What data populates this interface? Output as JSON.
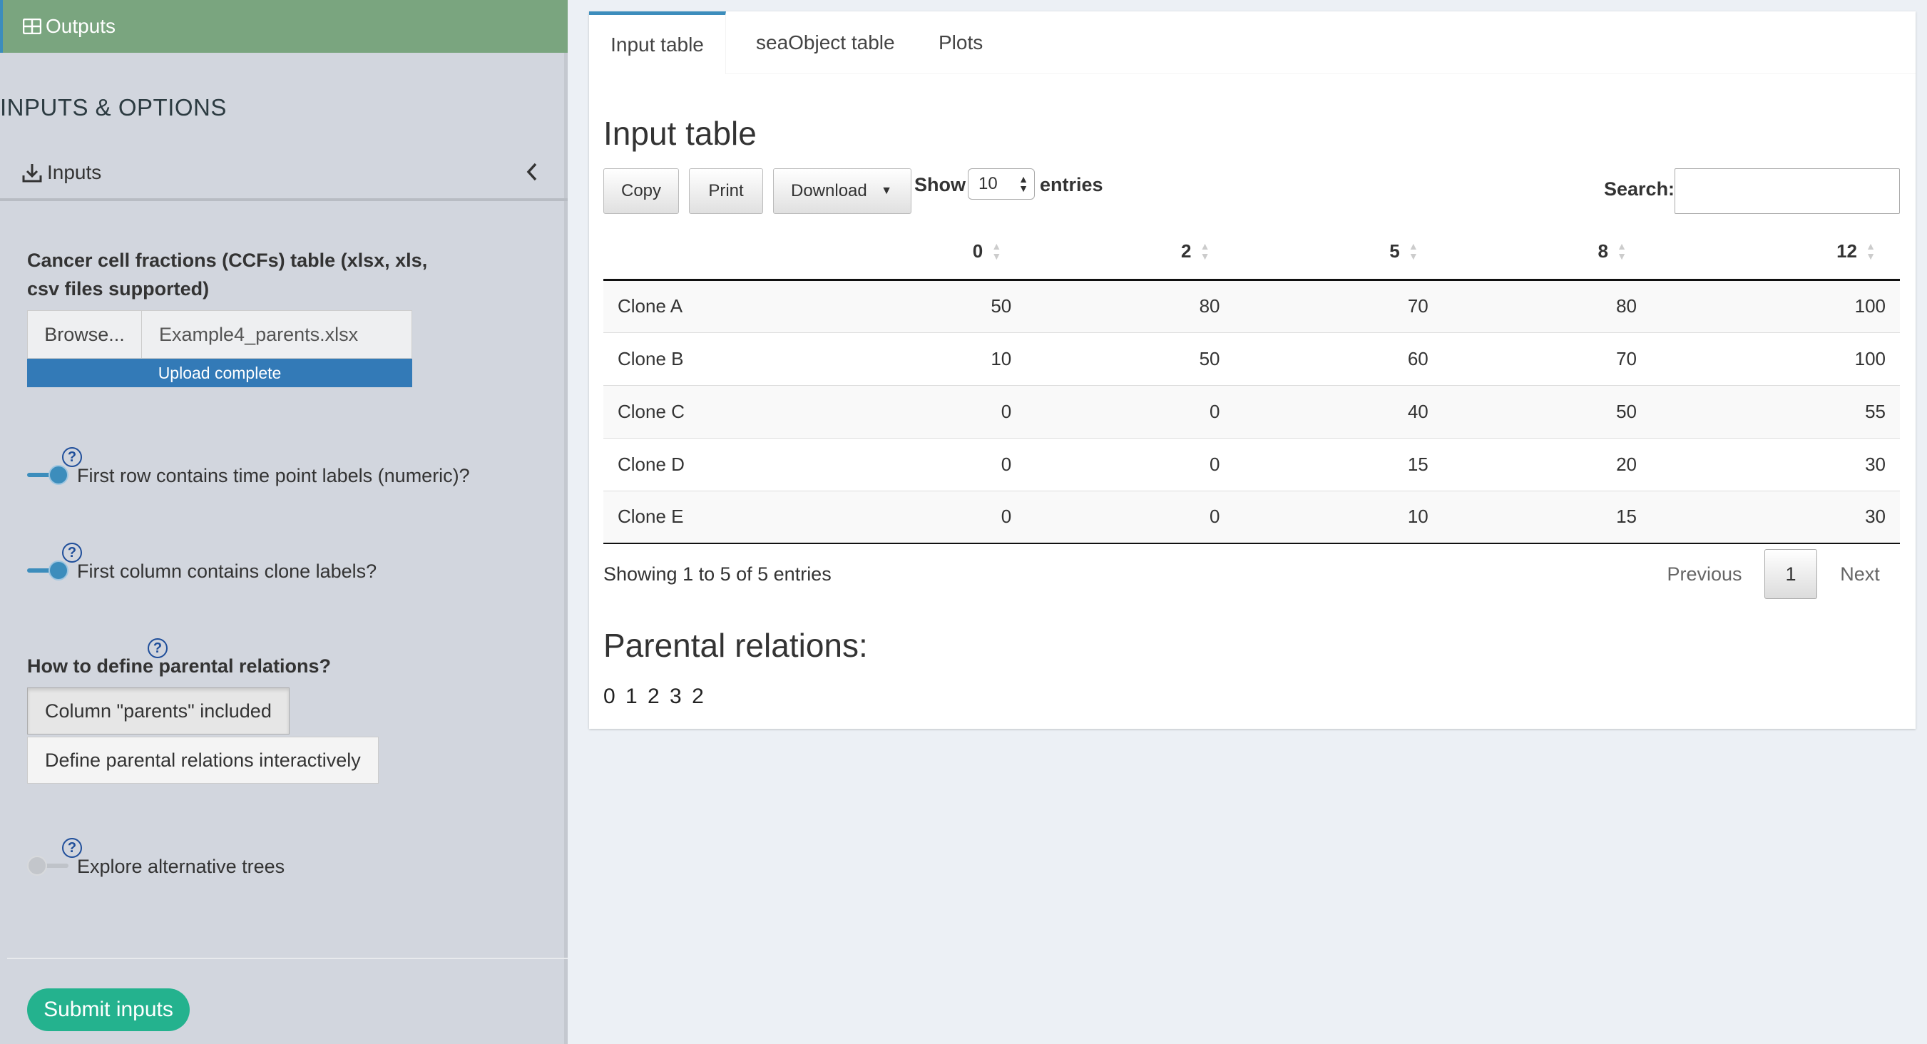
{
  "sidebar": {
    "outputs_label": "Outputs",
    "section_header": "INPUTS & OPTIONS",
    "inputs_label": "Inputs",
    "ccf_label_line1": "Cancer cell fractions (CCFs) table (xlsx, xls,",
    "ccf_label_line2": "csv files supported)",
    "browse_label": "Browse...",
    "file_name": "Example4_parents.xlsx",
    "upload_status": "Upload complete",
    "toggle_timepoints": {
      "label": "First row contains time point labels (numeric)?",
      "on": true
    },
    "toggle_clone_labels": {
      "label": "First column contains clone labels?",
      "on": true
    },
    "parental_label": "How to define parental relations?",
    "parental_opt1": "Column \"parents\" included",
    "parental_opt2": "Define parental relations interactively",
    "toggle_alt_trees": {
      "label": "Explore alternative trees",
      "on": false
    },
    "help_glyph": "?",
    "submit_label": "Submit inputs"
  },
  "tabs": [
    {
      "label": "Input table",
      "active": true
    },
    {
      "label": "seaObject table",
      "active": false
    },
    {
      "label": "Plots",
      "active": false
    }
  ],
  "main": {
    "title": "Input table",
    "buttons": {
      "copy": "Copy",
      "print": "Print",
      "download": "Download"
    },
    "show_label": "Show",
    "entries_label": "entries",
    "page_length": "10",
    "search_label": "Search:",
    "search_value": "",
    "columns": [
      "",
      "0",
      "2",
      "5",
      "8",
      "12"
    ],
    "rows": [
      [
        "Clone A",
        "50",
        "80",
        "70",
        "80",
        "100"
      ],
      [
        "Clone B",
        "10",
        "50",
        "60",
        "70",
        "100"
      ],
      [
        "Clone C",
        "0",
        "0",
        "40",
        "50",
        "55"
      ],
      [
        "Clone D",
        "0",
        "0",
        "15",
        "20",
        "30"
      ],
      [
        "Clone E",
        "0",
        "0",
        "10",
        "15",
        "30"
      ]
    ],
    "info": "Showing 1 to 5 of 5 entries",
    "pagination": {
      "previous": "Previous",
      "current": "1",
      "next": "Next"
    },
    "parental_title": "Parental relations:",
    "parental_values": "0 1 2 3 2"
  },
  "colors": {
    "outputs_bar": "#7aa57f",
    "accent": "#3c8dbc",
    "submit": "#24b28e",
    "upload": "#337ab7"
  }
}
